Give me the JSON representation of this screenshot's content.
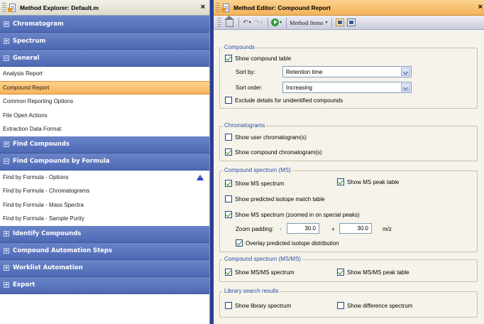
{
  "explorer": {
    "title": "Method Explorer: Default.m",
    "close": "×",
    "groups": [
      {
        "label": "Chromatogram",
        "toggle": "+"
      },
      {
        "label": "Spectrum",
        "toggle": "+"
      },
      {
        "label": "General",
        "toggle": "−"
      },
      {
        "label": "Find Compounds",
        "toggle": "+"
      },
      {
        "label": "Find Compounds by Formula",
        "toggle": "−"
      },
      {
        "label": "Identify Compounds",
        "toggle": "+"
      },
      {
        "label": "Compound Automation Steps",
        "toggle": "+"
      },
      {
        "label": "Worklist Automation",
        "toggle": "+"
      },
      {
        "label": "Export",
        "toggle": "+"
      }
    ],
    "general_items": [
      "Analysis Report",
      "Compound Report",
      "Common Reporting Options",
      "File Open Actions",
      "Extraction Data Format"
    ],
    "formula_items": [
      "Find by Formula - Options",
      "Find by Formula - Chromatograms",
      "Find by Formula - Mass Spectra",
      "Find by Formula - Sample Purity"
    ],
    "selected_item": "Compound Report"
  },
  "editor": {
    "title": "Method Editor: Compound Report",
    "close": "×",
    "toolbar": {
      "method_items": "Method Items",
      "caret": "▾",
      "undo": "↶",
      "redo": "↷"
    },
    "compounds": {
      "legend": "Compounds",
      "show_table": "Show compound table",
      "sort_by_label": "Sort by:",
      "sort_by_value": "Retention time",
      "sort_order_label": "Sort order:",
      "sort_order_value": "Increasing",
      "exclude": "Exclude details for unidentified compounds"
    },
    "chromatograms": {
      "legend": "Chromatograms",
      "user": "Show user chromatogram(s)",
      "compound": "Show compound chromatogram(s)"
    },
    "ms": {
      "legend": "Compound spectrum (MS)",
      "spectrum": "Show MS spectrum",
      "peak_table": "Show MS peak table",
      "isotope": "Show predicted isotope match table",
      "zoomed": "Show MS spectrum (zoomed in on special peaks)",
      "zoom_label": "Zoom padding:",
      "minus": "-",
      "plus": "+",
      "minus_value": "30.0",
      "plus_value": "30.0",
      "unit": "m/z",
      "overlay": "Overlay predicted isotope distribution"
    },
    "msms": {
      "legend": "Compound spectrum (MS/MS)",
      "spectrum": "Show MS/MS spectrum",
      "peak_table": "Show MS/MS peak table"
    },
    "library": {
      "legend": "Library search results",
      "spectrum": "Show library spectrum",
      "difference": "Show difference spectrum"
    }
  }
}
